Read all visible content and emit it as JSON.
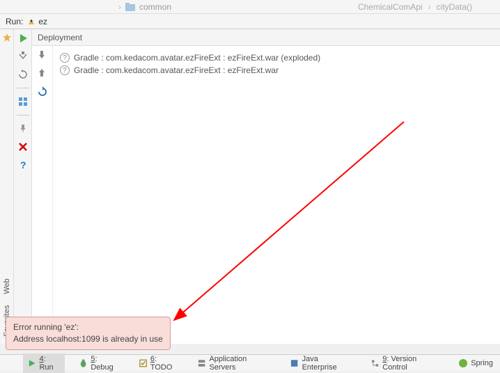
{
  "breadcrumb": {
    "folder_label": "common",
    "api_class": "ChemicalComApi",
    "api_method": "cityData()"
  },
  "run_header": {
    "label": "Run:",
    "config_name": "ez"
  },
  "deployment": {
    "header": "Deployment",
    "artifacts": [
      "Gradle : com.kedacom.avatar.ezFireExt : ezFireExt.war (exploded)",
      "Gradle : com.kedacom.avatar.ezFireExt : ezFireExt.war"
    ]
  },
  "error": {
    "line1": "Error running 'ez':",
    "line2": "Address localhost:1099 is already in use"
  },
  "left_gutter": {
    "web_label": "Web",
    "favorites_label": "Favorites"
  },
  "bottom_tabs": [
    {
      "num": "4",
      "label": ": Run"
    },
    {
      "num": "5",
      "label": ": Debug"
    },
    {
      "num": "6",
      "label": ": TODO"
    },
    {
      "num": "",
      "label": "Application Servers"
    },
    {
      "num": "",
      "label": "Java Enterprise"
    },
    {
      "num": "9",
      "label": ": Version Control"
    },
    {
      "num": "",
      "label": "Spring"
    }
  ]
}
